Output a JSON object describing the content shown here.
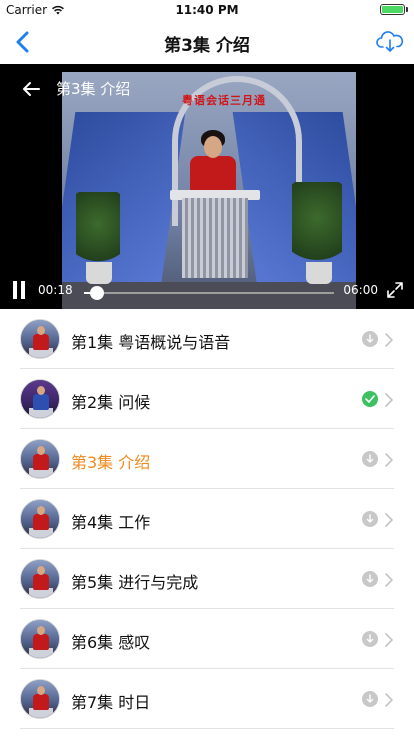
{
  "status_bar": {
    "carrier": "Carrier",
    "time": "11:40 PM"
  },
  "nav": {
    "title": "第3集 介绍",
    "back_icon": "chevron-left-icon",
    "download_icon": "cloud-download-icon",
    "accent_color": "#1e7ff0"
  },
  "player": {
    "title": "第3集 介绍",
    "current_time": "00:18",
    "total_time": "06:00",
    "progress": 0.05,
    "stage_sign": "粤语会话三月通"
  },
  "episodes": [
    {
      "title": "第1集 粤语概说与语音",
      "status": "pending",
      "active": false
    },
    {
      "title": "第2集 问候",
      "status": "downloaded",
      "active": false
    },
    {
      "title": "第3集 介绍",
      "status": "pending",
      "active": true
    },
    {
      "title": "第4集 工作",
      "status": "pending",
      "active": false
    },
    {
      "title": "第5集 进行与完成",
      "status": "pending",
      "active": false
    },
    {
      "title": "第6集 感叹",
      "status": "pending",
      "active": false
    },
    {
      "title": "第7集 时日",
      "status": "pending",
      "active": false
    }
  ],
  "colors": {
    "active_episode": "#f08a1c",
    "downloaded": "#3cc061",
    "pending": "#c8c8c8"
  }
}
